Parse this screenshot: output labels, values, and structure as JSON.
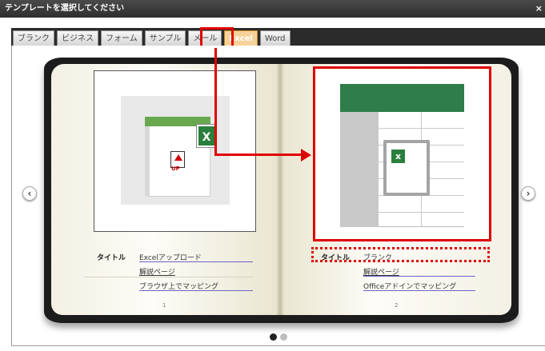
{
  "dialog": {
    "title": "テンプレートを選択してください",
    "close_label": "×"
  },
  "tabs": [
    {
      "label": "ブランク",
      "active": false
    },
    {
      "label": "ビジネス",
      "active": false
    },
    {
      "label": "フォーム",
      "active": false
    },
    {
      "label": "サンプル",
      "active": false
    },
    {
      "label": "メール",
      "active": false
    },
    {
      "label": "Excel",
      "active": true
    },
    {
      "label": "Word",
      "active": false
    }
  ],
  "templates": [
    {
      "key_label": "タイトル",
      "title": "Excelアップロード",
      "link": "解説ページ",
      "description": "ブラウザ上でマッピング",
      "page": "1",
      "icon": "excel-upload-icon"
    },
    {
      "key_label": "タイトル",
      "title": "ブランク",
      "link": "解説ページ",
      "description": "Officeアドインでマッピング",
      "page": "2",
      "icon": "excel-blank-icon"
    }
  ],
  "thumb": {
    "xl_badge": "X",
    "up_label": "UP",
    "doc_badge": "x"
  },
  "nav": {
    "prev_label": "‹",
    "next_label": "›"
  },
  "pager": {
    "active_index": 0,
    "count": 2
  },
  "colors": {
    "highlight": "#e00000",
    "excel_green": "#2e7d4a",
    "active_tab": "#f6d29a",
    "link_underline": "#6b63c9"
  }
}
